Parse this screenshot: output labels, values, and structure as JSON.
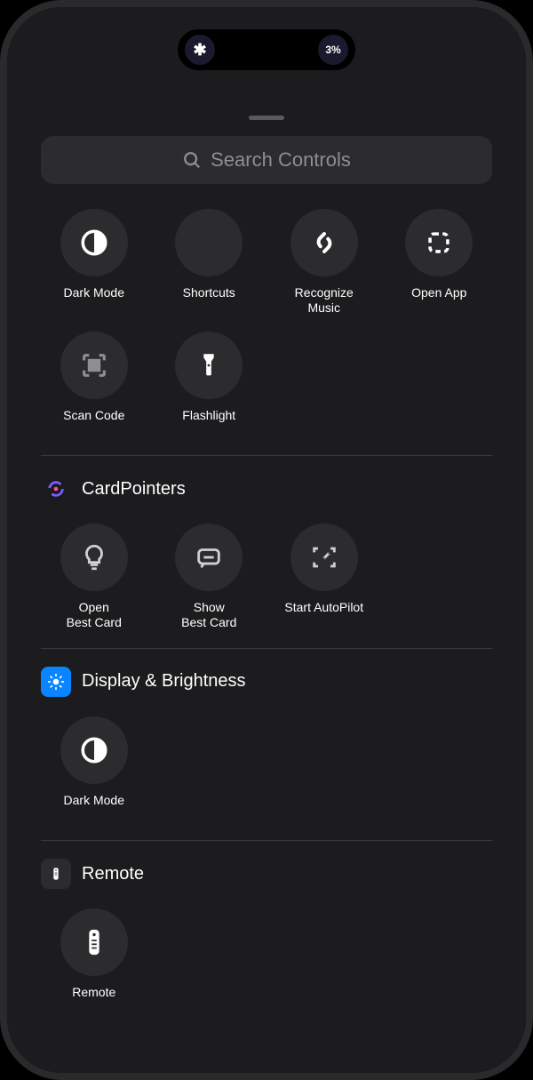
{
  "statusbar": {
    "left_glyph": "✱",
    "battery_pct": "3%"
  },
  "search": {
    "placeholder": "Search Controls"
  },
  "top_grid": [
    {
      "id": "dark-mode",
      "label": "Dark Mode"
    },
    {
      "id": "shortcuts",
      "label": "Shortcuts"
    },
    {
      "id": "recognize-music",
      "label": "Recognize\nMusic"
    },
    {
      "id": "open-app",
      "label": "Open App"
    },
    {
      "id": "scan-code",
      "label": "Scan Code"
    },
    {
      "id": "flashlight",
      "label": "Flashlight"
    }
  ],
  "sections": [
    {
      "id": "cardpointers",
      "title": "CardPointers",
      "items": [
        {
          "id": "open-best-card",
          "label": "Open\nBest Card"
        },
        {
          "id": "show-best-card",
          "label": "Show\nBest Card"
        },
        {
          "id": "start-autopilot",
          "label": "Start AutoPilot"
        }
      ]
    },
    {
      "id": "display-brightness",
      "title": "Display & Brightness",
      "items": [
        {
          "id": "dark-mode-2",
          "label": "Dark Mode"
        }
      ]
    },
    {
      "id": "remote",
      "title": "Remote",
      "items": [
        {
          "id": "remote-control",
          "label": "Remote"
        }
      ]
    }
  ]
}
